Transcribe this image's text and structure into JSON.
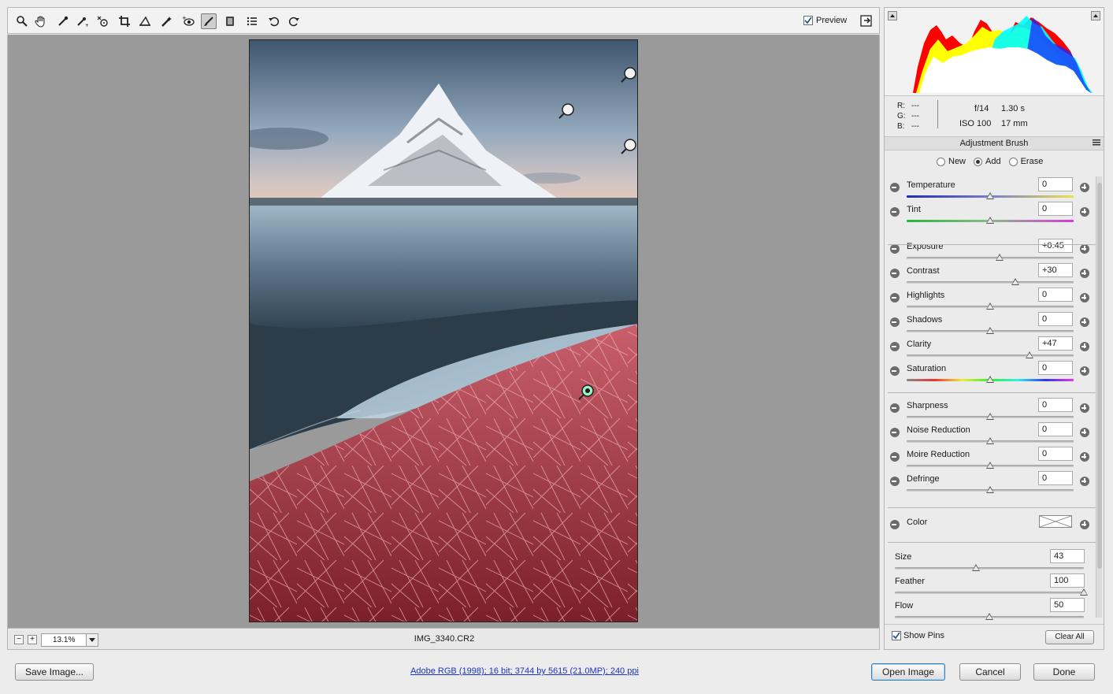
{
  "toolbar": {
    "tools": [
      "zoom-tool-icon",
      "hand-tool-icon",
      "white-balance-icon",
      "color-sampler-icon",
      "targeted-adjustment-icon",
      "crop-icon",
      "straighten-icon",
      "spot-removal-icon",
      "red-eye-icon",
      "adjustment-brush-icon",
      "graduated-filter-icon",
      "preferences-icon",
      "rotate-left-icon",
      "rotate-right-icon"
    ],
    "preview_label": "Preview",
    "preview_checked": true
  },
  "status": {
    "zoom": "13.1%",
    "filename": "IMG_3340.CR2"
  },
  "info": {
    "r_label": "R:",
    "r_value": "---",
    "g_label": "G:",
    "g_value": "---",
    "b_label": "B:",
    "b_value": "---",
    "aperture": "f/14",
    "shutter": "1.30 s",
    "iso": "ISO 100",
    "focal": "17 mm"
  },
  "panel": {
    "title": "Adjustment Brush",
    "modes": [
      {
        "label": "New",
        "selected": false
      },
      {
        "label": "Add",
        "selected": true
      },
      {
        "label": "Erase",
        "selected": false
      }
    ],
    "sliders": [
      {
        "label": "Temperature",
        "value": "0",
        "level": 0.5,
        "group": 1
      },
      {
        "label": "Tint",
        "value": "0",
        "level": 0.5,
        "group": 1
      },
      {
        "label": "Exposure",
        "value": "+0.45",
        "level": 0.555,
        "group": 2
      },
      {
        "label": "Contrast",
        "value": "+30",
        "level": 0.65,
        "group": 2
      },
      {
        "label": "Highlights",
        "value": "0",
        "level": 0.5,
        "group": 2
      },
      {
        "label": "Shadows",
        "value": "0",
        "level": 0.5,
        "group": 2
      },
      {
        "label": "Clarity",
        "value": "+47",
        "level": 0.735,
        "group": 2
      },
      {
        "label": "Saturation",
        "value": "0",
        "level": 0.5,
        "group": 2
      },
      {
        "label": "Sharpness",
        "value": "0",
        "level": 0.5,
        "group": 3
      },
      {
        "label": "Noise Reduction",
        "value": "0",
        "level": 0.5,
        "group": 3
      },
      {
        "label": "Moire Reduction",
        "value": "0",
        "level": 0.5,
        "group": 3
      },
      {
        "label": "Defringe",
        "value": "0",
        "level": 0.5,
        "group": 3
      }
    ],
    "color_label": "Color",
    "brush": [
      {
        "label": "Size",
        "value": "43",
        "level": 0.43
      },
      {
        "label": "Feather",
        "value": "100",
        "level": 1.0
      },
      {
        "label": "Flow",
        "value": "50",
        "level": 0.5
      }
    ],
    "show_pins_label": "Show Pins",
    "show_pins_checked": true,
    "clear_all_label": "Clear All"
  },
  "footer": {
    "save_label": "Save Image...",
    "workflow_label": "Adobe RGB (1998); 16 bit; 3744 by 5615 (21.0MP); 240 ppi",
    "open_label": "Open Image",
    "cancel_label": "Cancel",
    "done_label": "Done"
  },
  "colors": {
    "accent": "#3c7fb1",
    "mask_overlay": "#c8343c",
    "link": "#1a33c6"
  }
}
